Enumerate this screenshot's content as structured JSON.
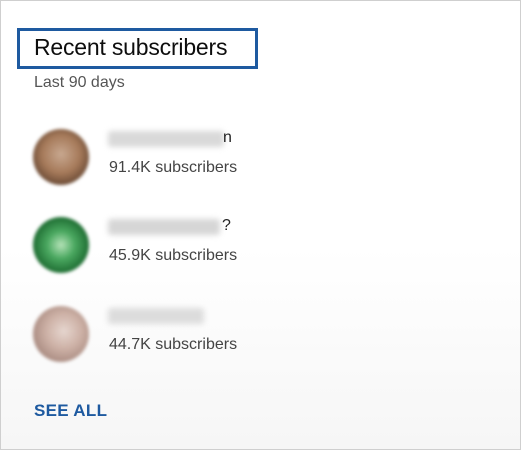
{
  "card": {
    "title": "Recent subscribers",
    "subtitle": "Last 90 days",
    "see_all_label": "SEE ALL"
  },
  "subscribers": [
    {
      "name_visible_tail": "n",
      "subscriber_count": "91.4K subscribers"
    },
    {
      "name_visible_tail": "?",
      "subscriber_count": "45.9K subscribers"
    },
    {
      "name_visible_tail": "",
      "subscriber_count": "44.7K subscribers"
    }
  ],
  "colors": {
    "accent": "#1e5aa0",
    "title_text": "#0d0d0d",
    "secondary_text": "#555555"
  }
}
